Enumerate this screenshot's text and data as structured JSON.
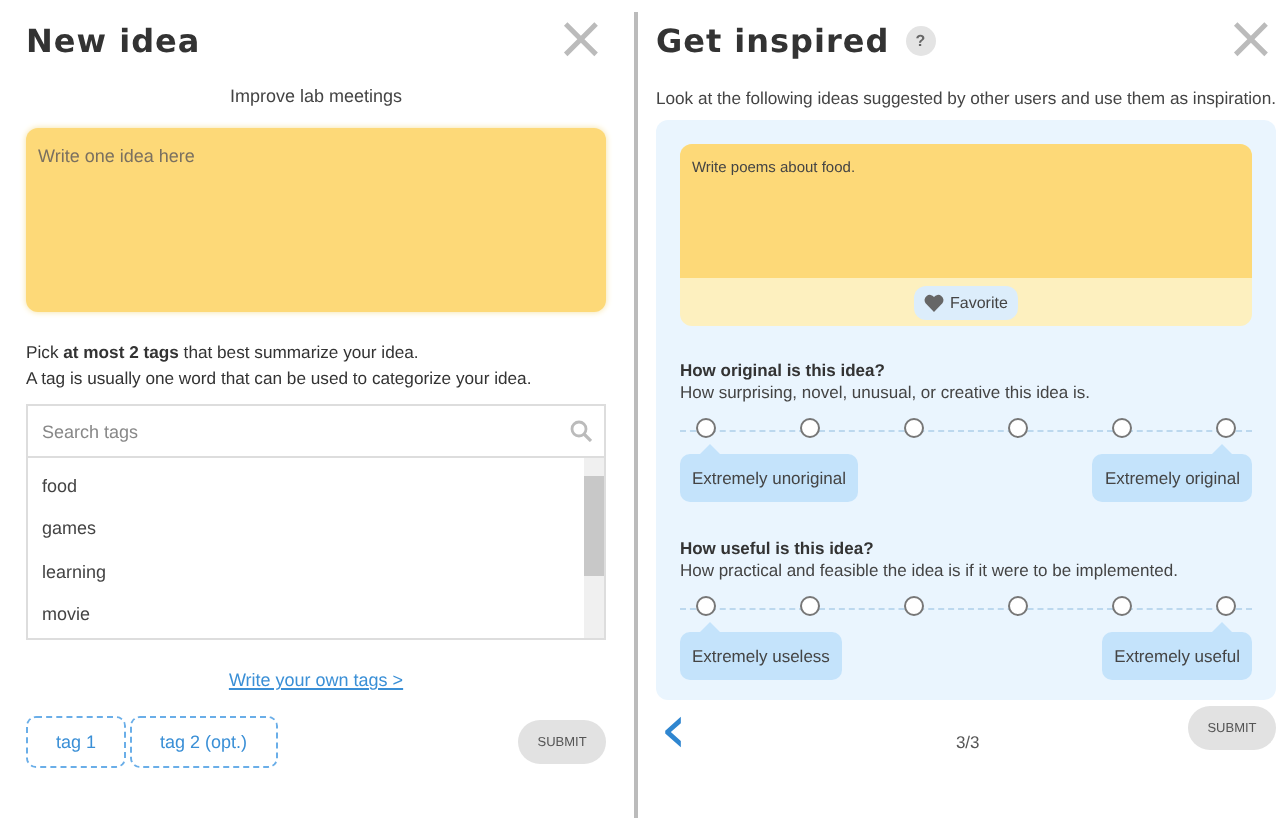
{
  "new_idea": {
    "title": "New idea",
    "close": "×",
    "topic": "Improve lab meetings",
    "idea_field": {
      "placeholder": "Write one idea here"
    },
    "instructions": [
      "Pick **at most 2 tags** that best summarize your idea.",
      "A tag is usually one word that can be used to categorize your idea."
    ],
    "tag_search": {
      "placeholder": "Search tags"
    },
    "tags": [
      {
        "label": "food",
        "selected": false
      },
      {
        "label": "games",
        "selected": false
      },
      {
        "label": "learning",
        "selected": false
      },
      {
        "label": "movie",
        "selected": false
      }
    ],
    "own_tags_link": "Write your own tags >",
    "tag_slots": [
      "tag 1",
      "tag 2 (opt.)"
    ],
    "submit": {
      "label": "SUBMIT",
      "disabled": true
    }
  },
  "inspiration": {
    "title": "Get inspired",
    "help": "?",
    "close": "×",
    "description": "Look at the following ideas suggested by other users and use them as inspiration.",
    "idea": {
      "text": "Write poems about food.",
      "favorite": {
        "label": "Favorite",
        "on": false
      }
    },
    "ratings": [
      {
        "question": "How original is this idea?",
        "hint": "How surprising, novel, unusual, or creative this idea is.",
        "options": [
          {
            "selected": false
          },
          {
            "selected": false
          },
          {
            "selected": false
          },
          {
            "selected": false
          },
          {
            "selected": false
          },
          {
            "selected": false
          }
        ],
        "min_label": "Extremely unoriginal",
        "max_label": "Extremely original"
      },
      {
        "question": "How useful is this idea?",
        "hint": "How practical and feasible the idea is if it were to be implemented.",
        "options": [
          {
            "selected": false
          },
          {
            "selected": false
          },
          {
            "selected": false
          },
          {
            "selected": false
          },
          {
            "selected": false
          },
          {
            "selected": false
          }
        ],
        "min_label": "Extremely useless",
        "max_label": "Extremely useful"
      }
    ],
    "back": "‹",
    "pager": "3/3",
    "submit": {
      "label": "SUBMIT",
      "disabled": true
    }
  }
}
